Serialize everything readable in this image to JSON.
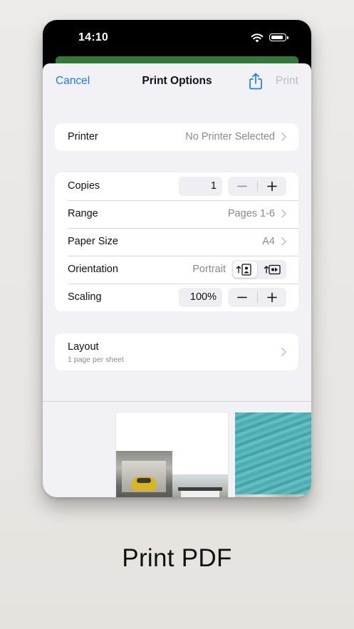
{
  "status_bar": {
    "time": "14:10",
    "icons": [
      "wifi-icon",
      "battery-icon"
    ]
  },
  "nav": {
    "cancel": "Cancel",
    "title": "Print Options",
    "share_icon": "share-icon",
    "print": "Print"
  },
  "printer": {
    "label": "Printer",
    "value": "No Printer Selected"
  },
  "options": {
    "copies": {
      "label": "Copies",
      "value": "1"
    },
    "range": {
      "label": "Range",
      "value": "Pages 1-6"
    },
    "paper_size": {
      "label": "Paper Size",
      "value": "A4"
    },
    "orientation": {
      "label": "Orientation",
      "value": "Portrait",
      "options": [
        "portrait-icon",
        "landscape-icon"
      ],
      "selected": "portrait-icon"
    },
    "scaling": {
      "label": "Scaling",
      "value": "100%"
    }
  },
  "layout": {
    "label": "Layout",
    "sublabel": "1 page per sheet"
  },
  "preview": {
    "pages": [
      "page-1-thumbnail",
      "page-2-thumbnail"
    ]
  },
  "caption": "Print PDF",
  "colors": {
    "accent": "#1a7cf5",
    "disabled": "#b9bcc4",
    "sheet_bg": "#f2f1f6",
    "secondary_text": "#8a8a8f",
    "green_bar": "#2f7a38"
  }
}
